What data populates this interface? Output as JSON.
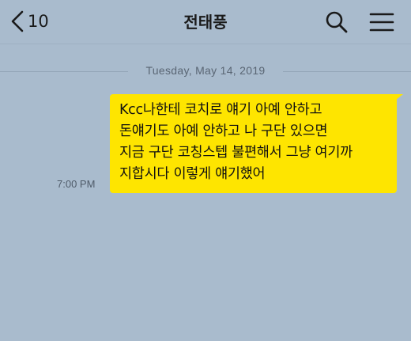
{
  "header": {
    "back_count": "10",
    "title": "전태풍",
    "back_icon": "chevron-left-icon",
    "search_icon": "search-icon",
    "menu_icon": "hamburger-menu-icon"
  },
  "chat": {
    "date_divider": "Tuesday, May 14, 2019",
    "message": {
      "time": "7:00 PM",
      "lines": [
        "Kcc나한테 코치로 얘기 아예 안하고",
        "돈얘기도 아예 안하고 나 구단 있으면",
        "지금 구단 코칭스텝 불편해서 그냥 여기까",
        "지합시다 이렇게 얘기했어"
      ]
    }
  },
  "colors": {
    "background": "#a9bbcd",
    "bubble": "#fee500",
    "text": "#1a1a1a"
  }
}
